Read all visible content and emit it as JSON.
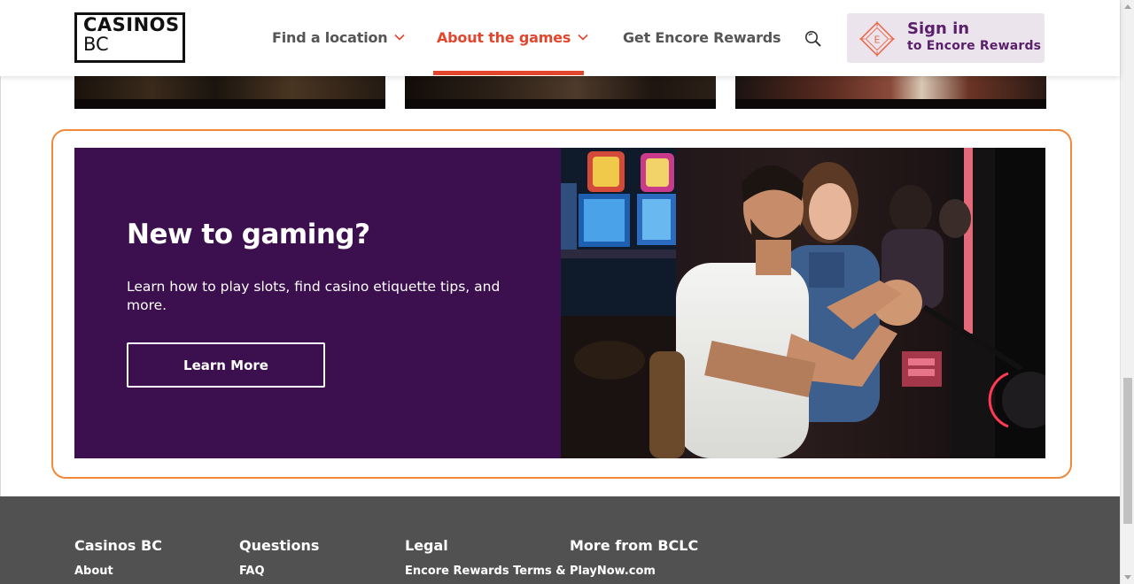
{
  "header": {
    "logo": {
      "line1": "CASINOS",
      "line2": "BC"
    },
    "nav": [
      {
        "label": "Find a location",
        "has_dropdown": true,
        "active": false
      },
      {
        "label": "About the games",
        "has_dropdown": true,
        "active": true
      },
      {
        "label": "Get Encore Rewards",
        "has_dropdown": false,
        "active": false
      }
    ],
    "search_icon": "search-icon",
    "signin": {
      "title": "Sign in",
      "subtitle": "to Encore Rewards",
      "badge_letter": "E"
    }
  },
  "promo": {
    "title": "New to gaming?",
    "description": "Learn how to play slots, find casino etiquette tips, and more.",
    "button_label": "Learn More",
    "image": "Couple cheering at a slot machine in a casino"
  },
  "footer": {
    "columns": [
      {
        "heading": "Casinos BC",
        "first_link": "About"
      },
      {
        "heading": "Questions",
        "first_link": "FAQ"
      },
      {
        "heading": "Legal",
        "first_link": "Encore Rewards Terms &"
      },
      {
        "heading": "More from BCLC",
        "first_link": "PlayNow.com"
      }
    ]
  },
  "colors": {
    "accent": "#e2462c",
    "promo_bg": "#3c0f4e",
    "signin_bg": "#ece4ec",
    "signin_text": "#5a1f6a",
    "footer_bg": "#515151",
    "promo_outline": "#f0893a"
  }
}
